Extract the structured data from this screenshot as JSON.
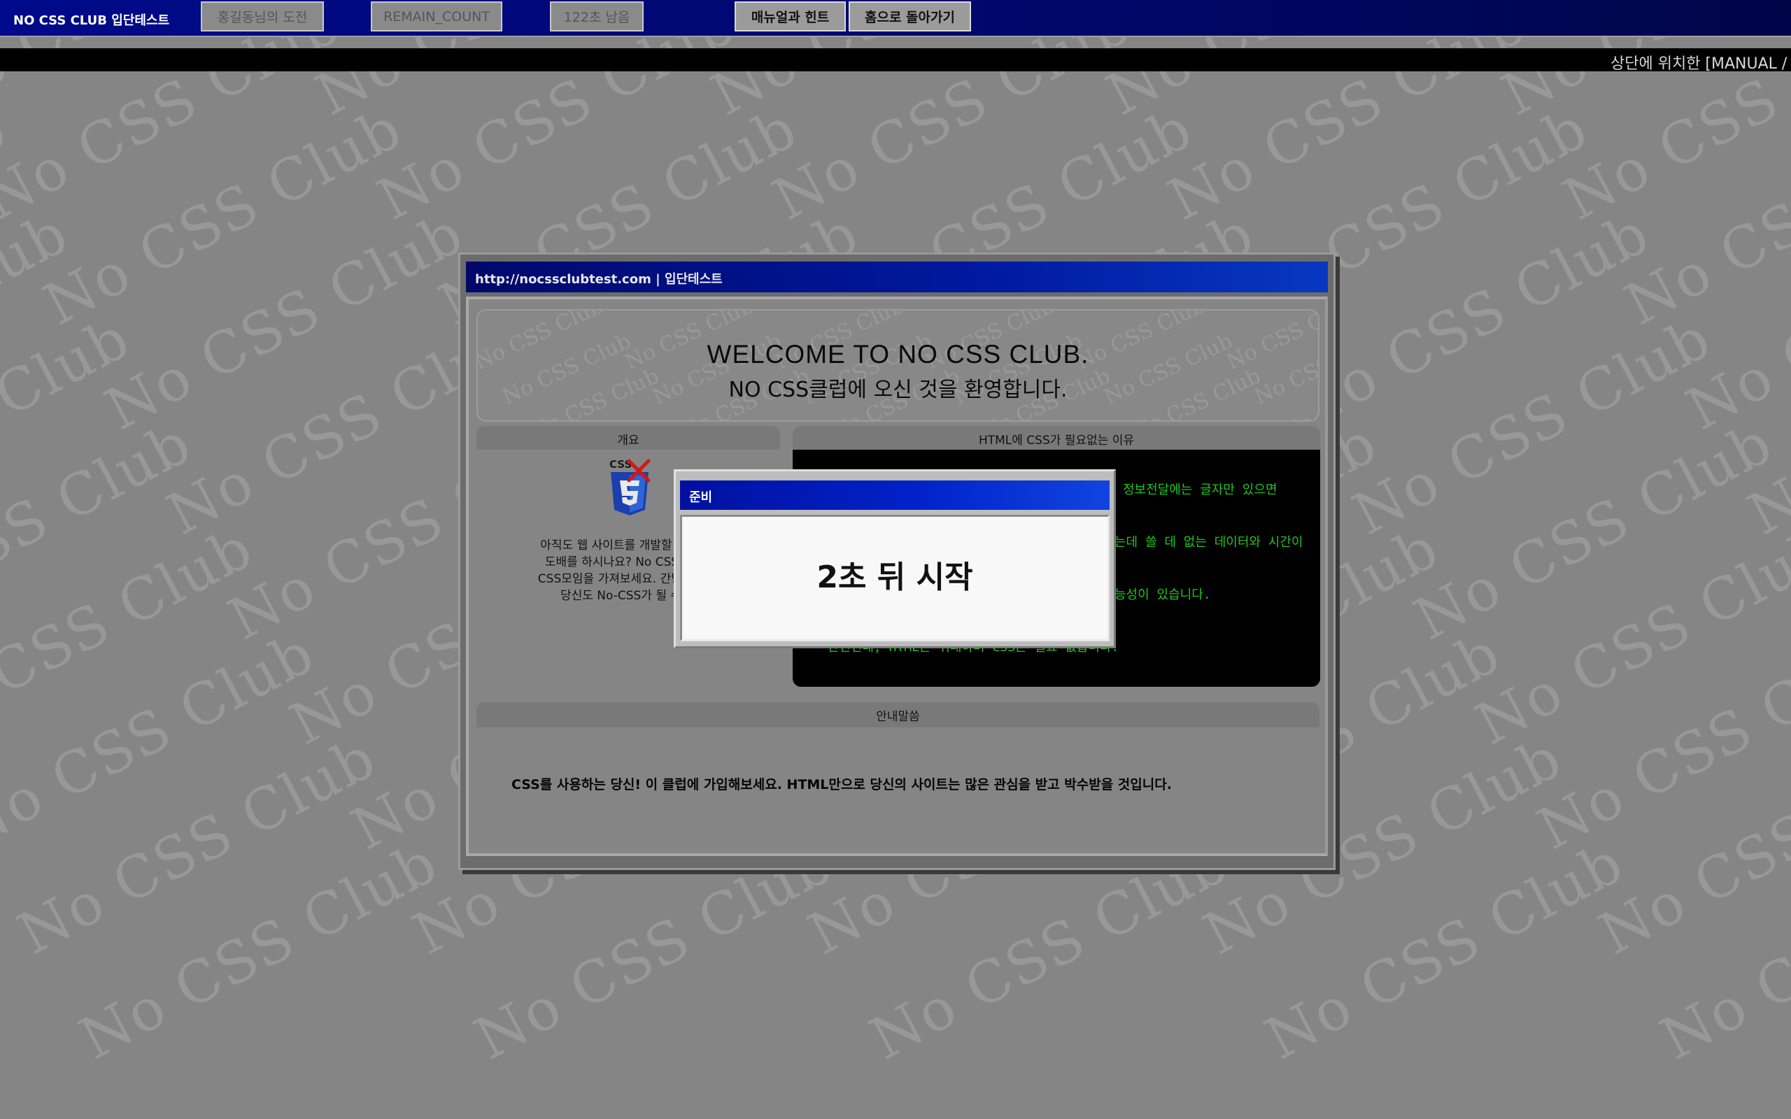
{
  "watermark_text": "No CSS Club",
  "topbar": {
    "site_title": "NO CSS CLUB 입단테스트",
    "challenger": "홍길동님의 도전",
    "remain_count": "REMAIN_COUNT",
    "time_left": "122초 남음",
    "manual_button": "매뉴얼과 힌트",
    "home_button": "홈으로 돌아가기"
  },
  "marquee": "상단에 위치한 [MANUAL / H",
  "window": {
    "title": "http://nocssclubtest.com | 입단테스트",
    "welcome_en": "WELCOME TO NO CSS CLUB.",
    "welcome_ko": "NO CSS클럽에 오신 것을 환영합니다.",
    "overview": {
      "heading": "개요",
      "text": [
        "아직도 웹 사이트를 개발할 때 이 페",
        "도배를 하시나요? No CSS클럽에",
        "CSS모임을 가져보세요. 간단한 입단",
        "당신도 No-CSS가 될 수 있"
      ]
    },
    "why": {
      "heading": "HTML에 CSS가 필요없는 이유",
      "items": [
        "정보전달에는 글자만 있으면",
        "는데 쓸 데 없는 데이터와 시간이",
        "능성이 있습니다.",
        "• 단언컨대, HTML은 위대하며 CSS는 필요 없습니다."
      ]
    },
    "notice": {
      "heading": "안내말씀",
      "text": "CSS를 사용하는 당신! 이 클럽에 가입해보세요. HTML만으로 당신의 사이트는 많은 관심을 받고 박수받을 것입니다."
    }
  },
  "modal": {
    "title": "준비",
    "countdown": "2초 뒤 시작"
  }
}
